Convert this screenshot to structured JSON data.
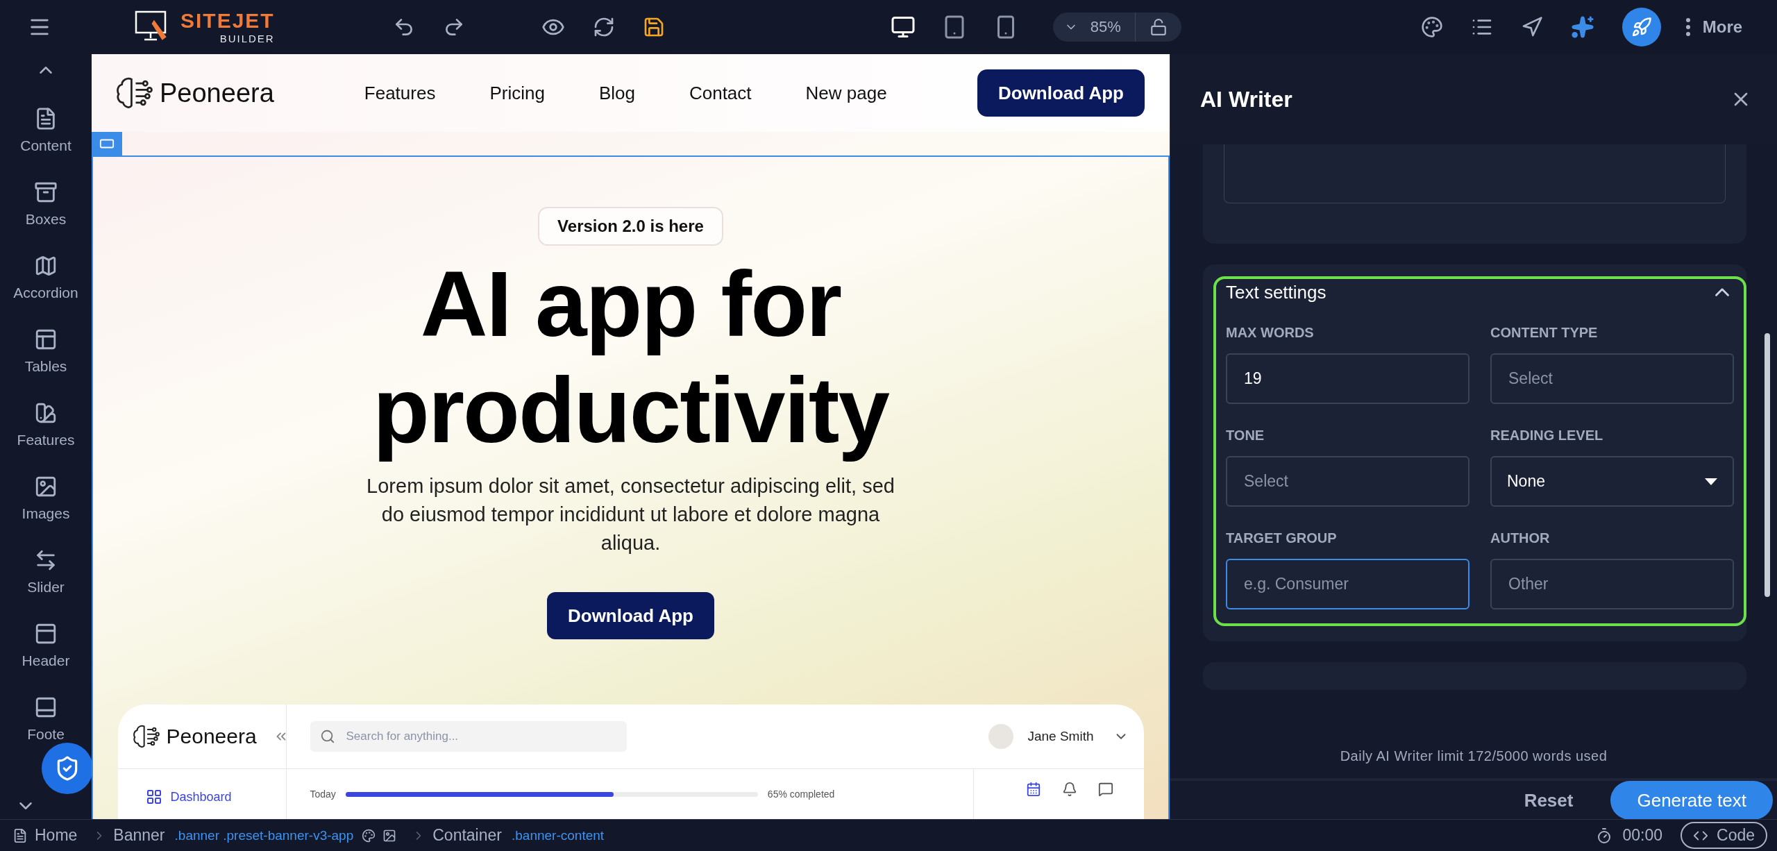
{
  "topbar": {
    "logo_title": "SITEJET",
    "logo_subtitle": "BUILDER",
    "devices": [
      {
        "kind": "desktop",
        "selected": true
      },
      {
        "kind": "tablet",
        "selected": false
      },
      {
        "kind": "phone",
        "selected": false
      }
    ],
    "zoom": "85%",
    "more": "More"
  },
  "sidebar": {
    "items": [
      {
        "label": "Content"
      },
      {
        "label": "Boxes"
      },
      {
        "label": "Accordion"
      },
      {
        "label": "Tables"
      },
      {
        "label": "Features"
      },
      {
        "label": "Images"
      },
      {
        "label": "Slider"
      },
      {
        "label": "Header"
      },
      {
        "label": "Foote"
      }
    ]
  },
  "site": {
    "brand": "Peoneera",
    "nav": [
      "Features",
      "Pricing",
      "Blog",
      "Contact",
      "New page"
    ],
    "cta": "Download App",
    "badge": "Version 2.0 is here",
    "heading": "AI app for productivity",
    "text": "Lorem ipsum dolor sit amet, consectetur adipiscing elit, sed do eiusmod tempor incididunt ut labore et dolore magna aliqua.",
    "button": "Download App",
    "dashboard": {
      "brand": "Peoneera",
      "search_placeholder": "Search for anything...",
      "user": "Jane Smith",
      "nav": [
        {
          "label": "Dashboard",
          "selected": true
        }
      ],
      "progress": {
        "label": "Today",
        "level": 0.65,
        "reading": "65% completed"
      }
    }
  },
  "panel": {
    "title": "AI Writer",
    "section": {
      "title": "Text settings",
      "expanded": true,
      "fields": [
        {
          "label": "MAX WORDS",
          "kind": "input",
          "value": "19",
          "focused": false
        },
        {
          "label": "CONTENT TYPE",
          "kind": "input",
          "placeholder": "Select",
          "focused": false
        },
        {
          "label": "TONE",
          "kind": "input",
          "placeholder": "Select",
          "focused": false
        },
        {
          "label": "READING LEVEL",
          "kind": "select",
          "value": "None",
          "focused": false
        },
        {
          "label": "TARGET GROUP",
          "kind": "input",
          "placeholder": "e.g. Consumer",
          "focused": true
        },
        {
          "label": "AUTHOR",
          "kind": "input",
          "placeholder": "Other",
          "focused": false
        }
      ]
    },
    "limit": "Daily AI Writer limit 172/5000 words used",
    "reset": "Reset",
    "generate": "Generate text"
  },
  "breadcrumb": [
    {
      "label": "Home",
      "kind": "page"
    },
    {
      "label": "Banner",
      "classes": ".banner .preset-banner-v3-app",
      "kind": "styled"
    },
    {
      "label": "Container",
      "classes": ".banner-content",
      "kind": "plain"
    }
  ],
  "status": {
    "timer": "00:00",
    "code": "Code"
  }
}
